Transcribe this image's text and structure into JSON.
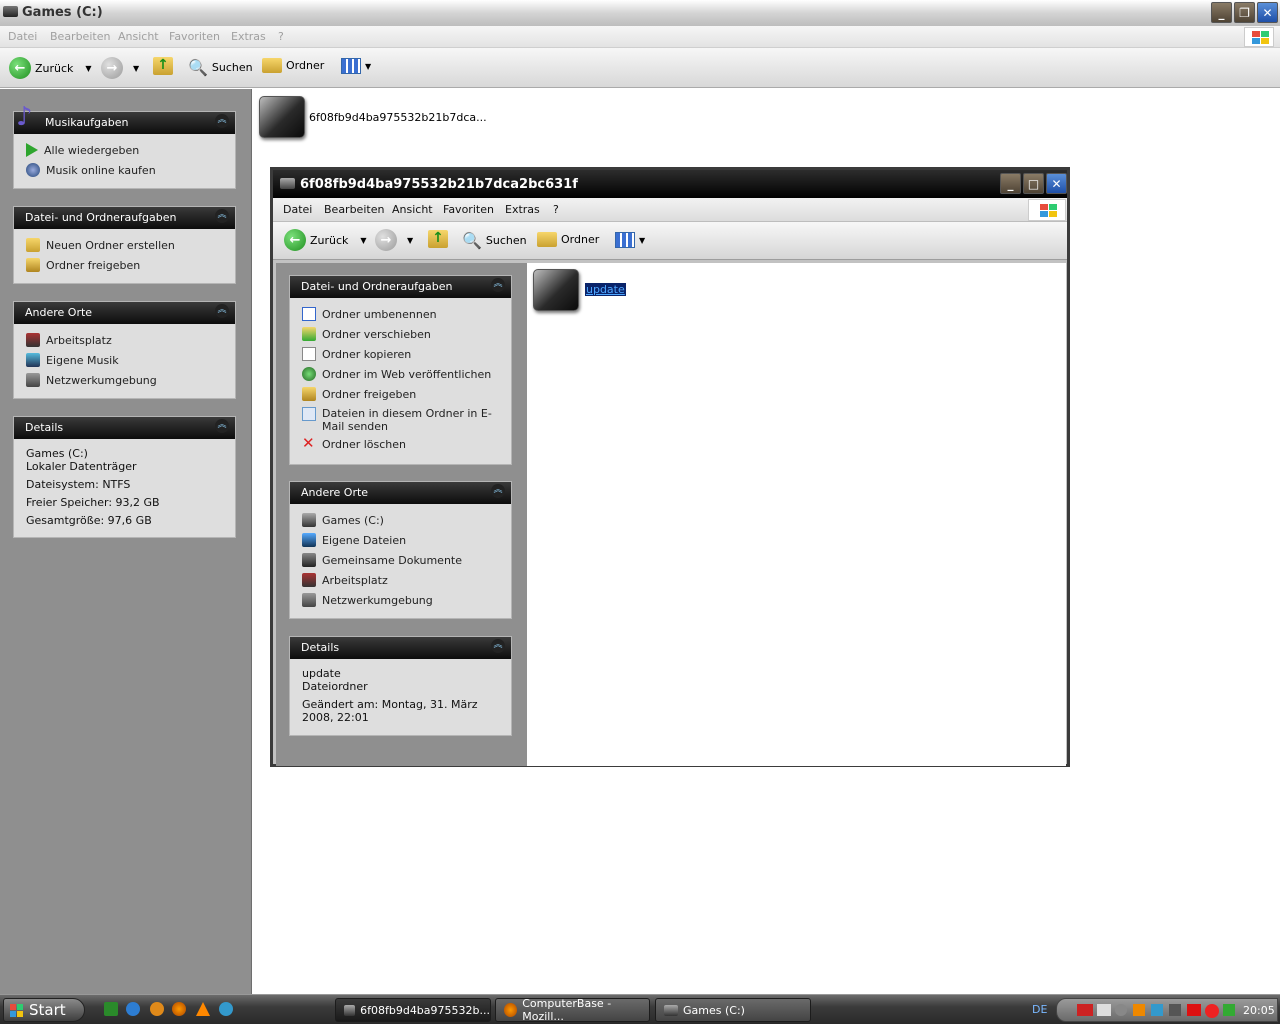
{
  "main_window": {
    "title": "Games (C:)",
    "menu": [
      "Datei",
      "Bearbeiten",
      "Ansicht",
      "Favoriten",
      "Extras",
      "?"
    ],
    "toolbar": {
      "back": "Zurück",
      "search": "Suchen",
      "folders": "Ordner"
    }
  },
  "left_pane": {
    "music_tasks": {
      "title": "Musikaufgaben",
      "items": [
        "Alle wiedergeben",
        "Musik online kaufen"
      ]
    },
    "file_tasks": {
      "title": "Datei- und Ordneraufgaben",
      "items": [
        "Neuen Ordner erstellen",
        "Ordner freigeben"
      ]
    },
    "other_places": {
      "title": "Andere Orte",
      "items": [
        "Arbeitsplatz",
        "Eigene Musik",
        "Netzwerkumgebung"
      ]
    },
    "details": {
      "title": "Details",
      "name": "Games (C:)",
      "type": "Lokaler Datenträger",
      "filesystem": "Dateisystem: NTFS",
      "free": "Freier Speicher: 93,2 GB",
      "total": "Gesamtgröße: 97,6 GB"
    }
  },
  "main_content": {
    "folder_name": "6f08fb9d4ba975532b21b7dca..."
  },
  "child_window": {
    "title": "6f08fb9d4ba975532b21b7dca2bc631f",
    "menu": [
      "Datei",
      "Bearbeiten",
      "Ansicht",
      "Favoriten",
      "Extras",
      "?"
    ],
    "toolbar": {
      "back": "Zurück",
      "search": "Suchen",
      "folders": "Ordner"
    },
    "file_tasks": {
      "title": "Datei- und Ordneraufgaben",
      "items": [
        "Ordner umbenennen",
        "Ordner verschieben",
        "Ordner kopieren",
        "Ordner im Web veröffentlichen",
        "Ordner freigeben",
        "Dateien in diesem Ordner in E-Mail senden",
        "Ordner löschen"
      ]
    },
    "other_places": {
      "title": "Andere Orte",
      "items": [
        "Games (C:)",
        "Eigene Dateien",
        "Gemeinsame Dokumente",
        "Arbeitsplatz",
        "Netzwerkumgebung"
      ]
    },
    "details": {
      "title": "Details",
      "name": "update",
      "type": "Dateiordner",
      "modified": "Geändert am: Montag, 31. März 2008, 22:01"
    },
    "folder_name": "update"
  },
  "taskbar": {
    "start": "Start",
    "buttons": [
      "6f08fb9d4ba975532b...",
      "ComputerBase - Mozill...",
      "Games (C:)"
    ],
    "lang": "DE",
    "clock": "20:05"
  }
}
